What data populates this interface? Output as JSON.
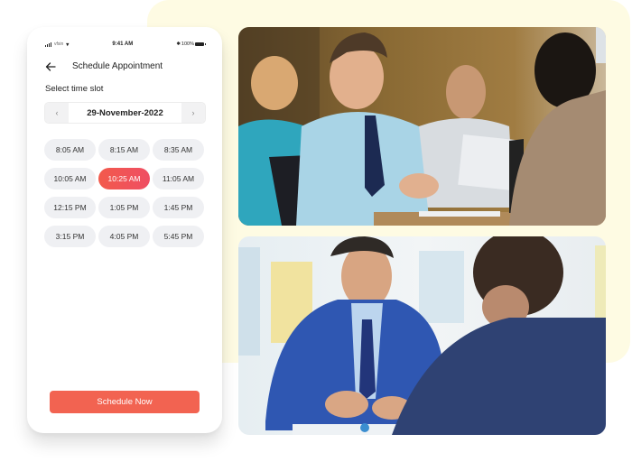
{
  "status_bar": {
    "carrier": "vfsin",
    "time": "9:41 AM",
    "battery": "100%"
  },
  "header": {
    "title": "Schedule Appointment",
    "back_icon": "arrow-left-icon"
  },
  "time_slot": {
    "label": "Select time slot",
    "date": "29-November-2022",
    "prev_icon": "chevron-left-icon",
    "next_icon": "chevron-right-icon",
    "selected": "10:25 AM",
    "slots": [
      "8:05 AM",
      "8:15 AM",
      "8:35 AM",
      "10:05 AM",
      "10:25 AM",
      "11:05 AM",
      "12:15 PM",
      "1:05 PM",
      "1:45 PM",
      "3:15 PM",
      "4:05 PM",
      "5:45 PM"
    ]
  },
  "actions": {
    "schedule_label": "Schedule Now"
  },
  "photos": [
    {
      "description": "Smiling young man in light blue shirt and tie at an interview table"
    },
    {
      "description": "Smiling man in blue suit talking with a colleague across a desk"
    }
  ],
  "colors": {
    "accent": "#f26351",
    "backdrop": "#fefbe3",
    "slot_bg": "#eff0f3"
  }
}
